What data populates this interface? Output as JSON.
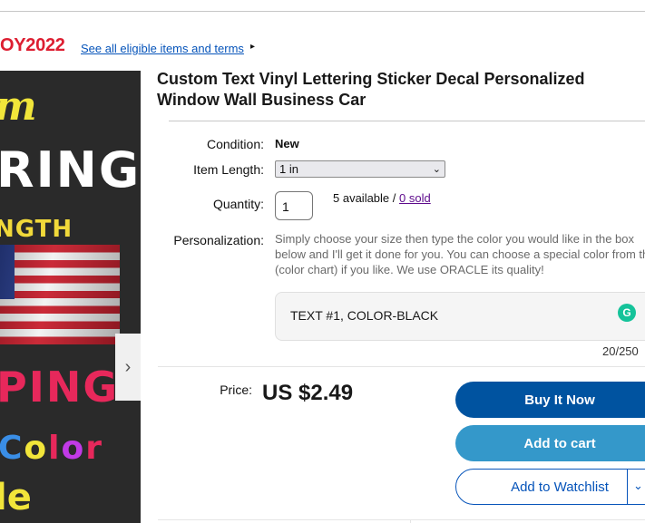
{
  "promo": {
    "code": "OY2022",
    "link": "See all eligible items and terms",
    "arrow": "▸"
  },
  "listing_image": {
    "lines": [
      "m",
      "RING",
      "NGTH",
      "PING",
      "Color",
      "le"
    ],
    "carousel_next": "›"
  },
  "title": "Custom Text Vinyl Lettering Sticker Decal Personalized Window Wall Business Car",
  "condition": {
    "label": "Condition:",
    "value": "New"
  },
  "item_length": {
    "label": "Item Length:",
    "value": "1 in"
  },
  "quantity": {
    "label": "Quantity:",
    "value": "1",
    "available": "5 available /",
    "sold": "0 sold"
  },
  "personalization": {
    "label": "Personalization:",
    "instructions": "Simply choose your size then type the color you would like in the box below and I'll get it done for you. You can choose a special color from the (color chart) if you like. We use ORACLE its quality!",
    "text_value": "TEXT #1, COLOR-BLACK",
    "char_count": "20/250",
    "grammar_icon": "G"
  },
  "price": {
    "label": "Price:",
    "value": "US $2.49"
  },
  "actions": {
    "buy_now": "Buy It Now",
    "add_to_cart": "Add to cart",
    "watchlist": "Add to Watchlist"
  },
  "colors": {
    "promo_red": "#dd1e31",
    "link_blue": "#0654ba",
    "buy_now_bg": "#0053a0",
    "add_cart_bg": "#3498ca",
    "sold_purple": "#5e0b8c"
  }
}
